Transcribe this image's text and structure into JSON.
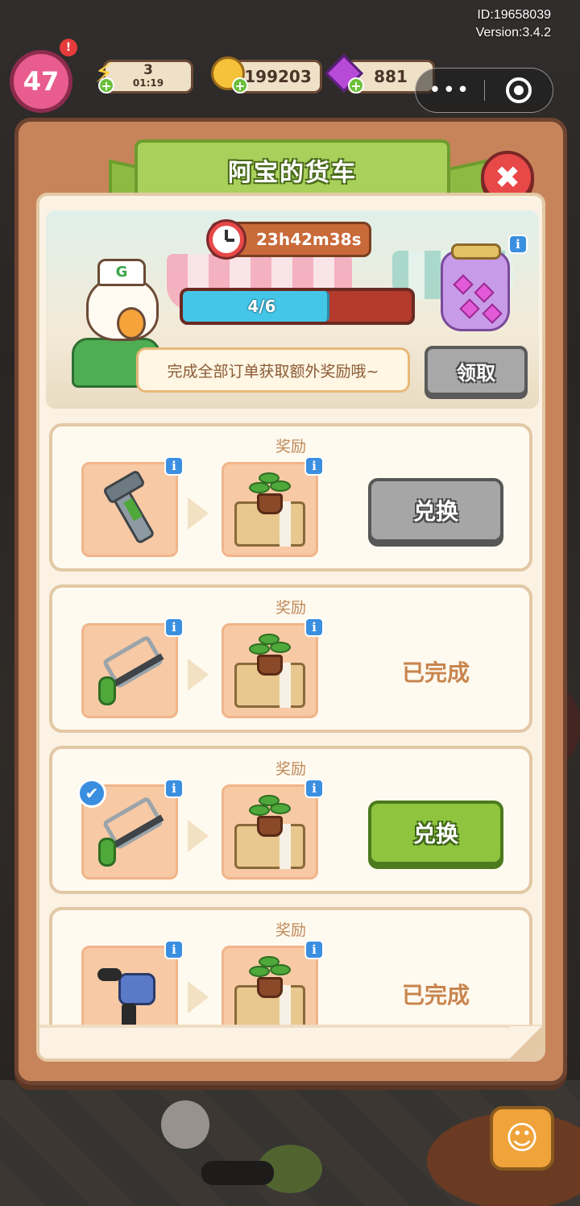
{
  "meta": {
    "id_text": "ID:19658039",
    "version_text": "Version:3.4.2"
  },
  "topbar": {
    "level": "47",
    "level_alert": "!",
    "energy": {
      "value": "3",
      "timer": "01:19",
      "icon": "lightning-icon"
    },
    "coins": {
      "value": "199203",
      "icon": "coin-icon"
    },
    "gems": {
      "value": "881",
      "icon": "gem-icon"
    },
    "plus_symbol": "+",
    "miniapp": {
      "more_symbol": "•••",
      "icon_target": "target-icon"
    }
  },
  "dialog": {
    "title": "阿宝的货车",
    "close_symbol": "✖",
    "banner": {
      "timer": "23h42m38s",
      "progress": {
        "current": 4,
        "total": 6,
        "label": "4/6"
      },
      "hint": "完成全部订单获取额外奖励哦~",
      "claim_label": "领取",
      "reward_icon": "gem-jar-icon"
    },
    "info_symbol": "i",
    "orders": [
      {
        "label": "奖励",
        "item": "wrench",
        "reward": "plant-box",
        "state": "exchange_disabled",
        "action_label": "兑换",
        "checked": false
      },
      {
        "label": "奖励",
        "item": "saw",
        "reward": "plant-box",
        "state": "done",
        "action_label": "已完成",
        "checked": false
      },
      {
        "label": "奖励",
        "item": "saw",
        "reward": "plant-box",
        "state": "exchange_ready",
        "action_label": "兑换",
        "checked": true
      },
      {
        "label": "奖励",
        "item": "drill",
        "reward": "plant-box",
        "state": "done",
        "action_label": "已完成",
        "checked": false
      }
    ],
    "check_symbol": "✔"
  },
  "colors": {
    "panel": "#c7845a",
    "ribbon_green": "#a8d05a",
    "exchange_green": "#8ec43e",
    "disabled_gray": "#a6a6a6",
    "progress_fill": "#43c6e8",
    "done_text": "#c8854e"
  }
}
